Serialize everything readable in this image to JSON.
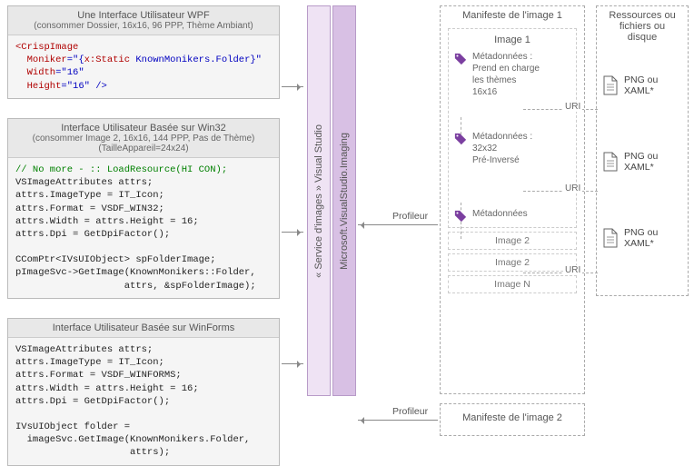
{
  "left": {
    "wpf": {
      "title": "Une Interface Utilisateur WPF",
      "subtitle": "(consommer Dossier, 16x16, 96 PPP, Thème Ambiant)",
      "code_l1a": "<CrispImage",
      "code_l2a": "  Moniker",
      "code_l2b": "=\"{",
      "code_l2c": "x:Static",
      "code_l2d": " KnownMonikers.Folder}\"",
      "code_l3a": "  Width",
      "code_l3b": "=\"16\"",
      "code_l4a": "  Height",
      "code_l4b": "=\"16\" />"
    },
    "win32": {
      "title": "Interface Utilisateur Basée sur Win32",
      "subtitle1": "(consommer Image 2, 16x16, 144 PPP, Pas de Thème)",
      "subtitle2": "(TailleAppareil=24x24)",
      "code_l1": "// No more - :: LoadResource(HI CON);",
      "code_l2": "VSImageAttributes attrs;",
      "code_l3": "attrs.ImageType = IT_Icon;",
      "code_l4": "attrs.Format = VSDF_WIN32;",
      "code_l5": "attrs.Width = attrs.Height = 16;",
      "code_l6": "attrs.Dpi = GetDpiFactor();",
      "code_l7": "",
      "code_l8": "CComPtr<IVsUIObject> spFolderImage;",
      "code_l9": "pImageSvc->GetImage(KnownMonikers::Folder,",
      "code_l10": "                   attrs, &spFolderImage);"
    },
    "winforms": {
      "title": "Interface Utilisateur Basée sur WinForms",
      "code_l1": "VSImageAttributes attrs;",
      "code_l2": "attrs.ImageType = IT_Icon;",
      "code_l3": "attrs.Format = VSDF_WINFORMS;",
      "code_l4": "attrs.Width = attrs.Height = 16;",
      "code_l5": "attrs.Dpi = GetDpiFactor();",
      "code_l6": "",
      "code_l7": "IVsUIObject folder =",
      "code_l8": "  imageSvc.GetImage(KnownMonikers.Folder,",
      "code_l9": "                    attrs);"
    }
  },
  "middle": {
    "service": "« Service d'images » Visual Studio",
    "imaging": "Microsoft.VisualStudio.Imaging"
  },
  "right": {
    "manifest1_title": "Manifeste de l'image 1",
    "manifest2_title": "Manifeste de l'image 2",
    "image1_title": "Image 1",
    "meta1_l1": "Métadonnées :",
    "meta1_l2": "Prend en charge",
    "meta1_l3": "les thèmes",
    "meta1_l4": "16x16",
    "meta2_l1": "Métadonnées :",
    "meta2_l2": "32x32",
    "meta2_l3": "Pré-Inversé",
    "meta3": "Métadonnées",
    "uri": "URI",
    "image2a": "Image 2",
    "image2b": "Image 2",
    "imageN": "Image N",
    "resources_title": "Ressources ou fichiers ou disque",
    "res_label": "PNG ou XAML*",
    "profiler": "Profileur"
  }
}
